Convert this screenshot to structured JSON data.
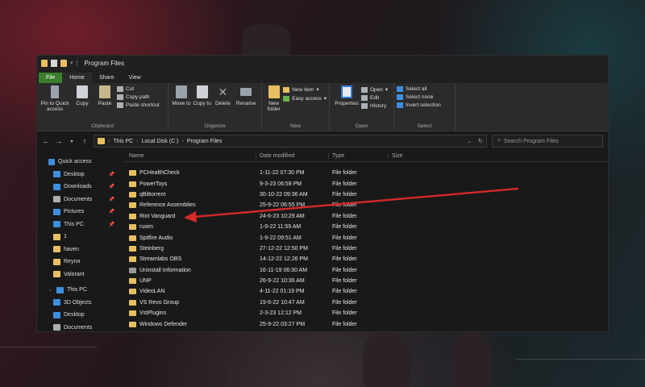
{
  "window": {
    "title": "Program Files"
  },
  "tabs": [
    "File",
    "Home",
    "Share",
    "View"
  ],
  "ribbon": {
    "clipboard": {
      "pin": "Pin to Quick access",
      "copy": "Copy",
      "paste": "Paste",
      "cut": "Cut",
      "copy_path": "Copy path",
      "paste_shortcut": "Paste shortcut",
      "label": "Clipboard"
    },
    "organize": {
      "move_to": "Move to",
      "copy_to": "Copy to",
      "delete": "Delete",
      "rename": "Rename",
      "label": "Organize"
    },
    "new": {
      "new_folder": "New folder",
      "new_item": "New item",
      "easy_access": "Easy access",
      "label": "New"
    },
    "open": {
      "properties": "Properties",
      "open": "Open",
      "edit": "Edit",
      "history": "History",
      "label": "Open"
    },
    "select": {
      "select_all": "Select all",
      "select_none": "Select none",
      "invert": "Invert selection",
      "label": "Select"
    }
  },
  "address": {
    "crumbs": [
      "This PC",
      "Local Disk (C:)",
      "Program Files"
    ],
    "search_placeholder": "Search Program Files"
  },
  "sidebar": {
    "quick_access": "Quick access",
    "items": [
      "Desktop",
      "Downloads",
      "Documents",
      "Pictures",
      "This PC",
      "1",
      "haven",
      "Reyna",
      "Valorant"
    ],
    "this_pc": "This PC",
    "pc_items": [
      "3D Objects",
      "Desktop",
      "Documents"
    ]
  },
  "columns": {
    "name": "Name",
    "date": "Date modified",
    "type": "Type",
    "size": "Size"
  },
  "files": [
    {
      "name": "PCHealthCheck",
      "date": "1-11-22 07:30 PM",
      "type": "File folder"
    },
    {
      "name": "PowerToys",
      "date": "9-3-23 06:59 PM",
      "type": "File folder"
    },
    {
      "name": "qBittorrent",
      "date": "30-10-22 09:36 AM",
      "type": "File folder"
    },
    {
      "name": "Reference Assemblies",
      "date": "25-9-22 06:55 PM",
      "type": "File folder"
    },
    {
      "name": "Riot Vanguard",
      "date": "24-6-23 10:29 AM",
      "type": "File folder"
    },
    {
      "name": "ruxim",
      "date": "1-9-22 11:59 AM",
      "type": "File folder"
    },
    {
      "name": "Spitfire Audio",
      "date": "1-9-22 09:51 AM",
      "type": "File folder"
    },
    {
      "name": "Steinberg",
      "date": "27-12-22 12:50 PM",
      "type": "File folder"
    },
    {
      "name": "Streamlabs OBS",
      "date": "14-12-22 12:26 PM",
      "type": "File folder"
    },
    {
      "name": "Uninstall Information",
      "date": "16-11-19 06:30 AM",
      "type": "File folder"
    },
    {
      "name": "UNP",
      "date": "26-9-22 10:36 AM",
      "type": "File folder"
    },
    {
      "name": "VideoLAN",
      "date": "4-11-22 01:19 PM",
      "type": "File folder"
    },
    {
      "name": "VS Revo Group",
      "date": "19-6-22 10:47 AM",
      "type": "File folder"
    },
    {
      "name": "VstPlugins",
      "date": "2-3-23 12:12 PM",
      "type": "File folder"
    },
    {
      "name": "Windows Defender",
      "date": "25-9-22 03:27 PM",
      "type": "File folder"
    }
  ],
  "annotation": {
    "color": "#d42a2a",
    "target": "Riot Vanguard"
  }
}
